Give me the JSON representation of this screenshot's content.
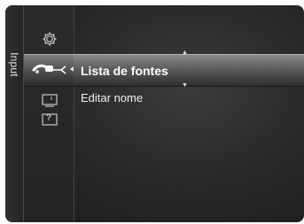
{
  "sidebar": {
    "tab_label": "Input"
  },
  "icons": [
    {
      "name": "gear-icon"
    },
    {
      "name": "input-cable-icon"
    },
    {
      "name": "tv-icon"
    },
    {
      "name": "help-icon",
      "glyph": "?"
    }
  ],
  "menu": {
    "items": [
      {
        "label": "Lista de fontes",
        "selected": true
      },
      {
        "label": "Editar nome",
        "selected": false
      }
    ]
  },
  "colors": {
    "panel_bg": "#2a2a2a",
    "highlight": "#6a6a6a",
    "text": "#ffffff"
  }
}
